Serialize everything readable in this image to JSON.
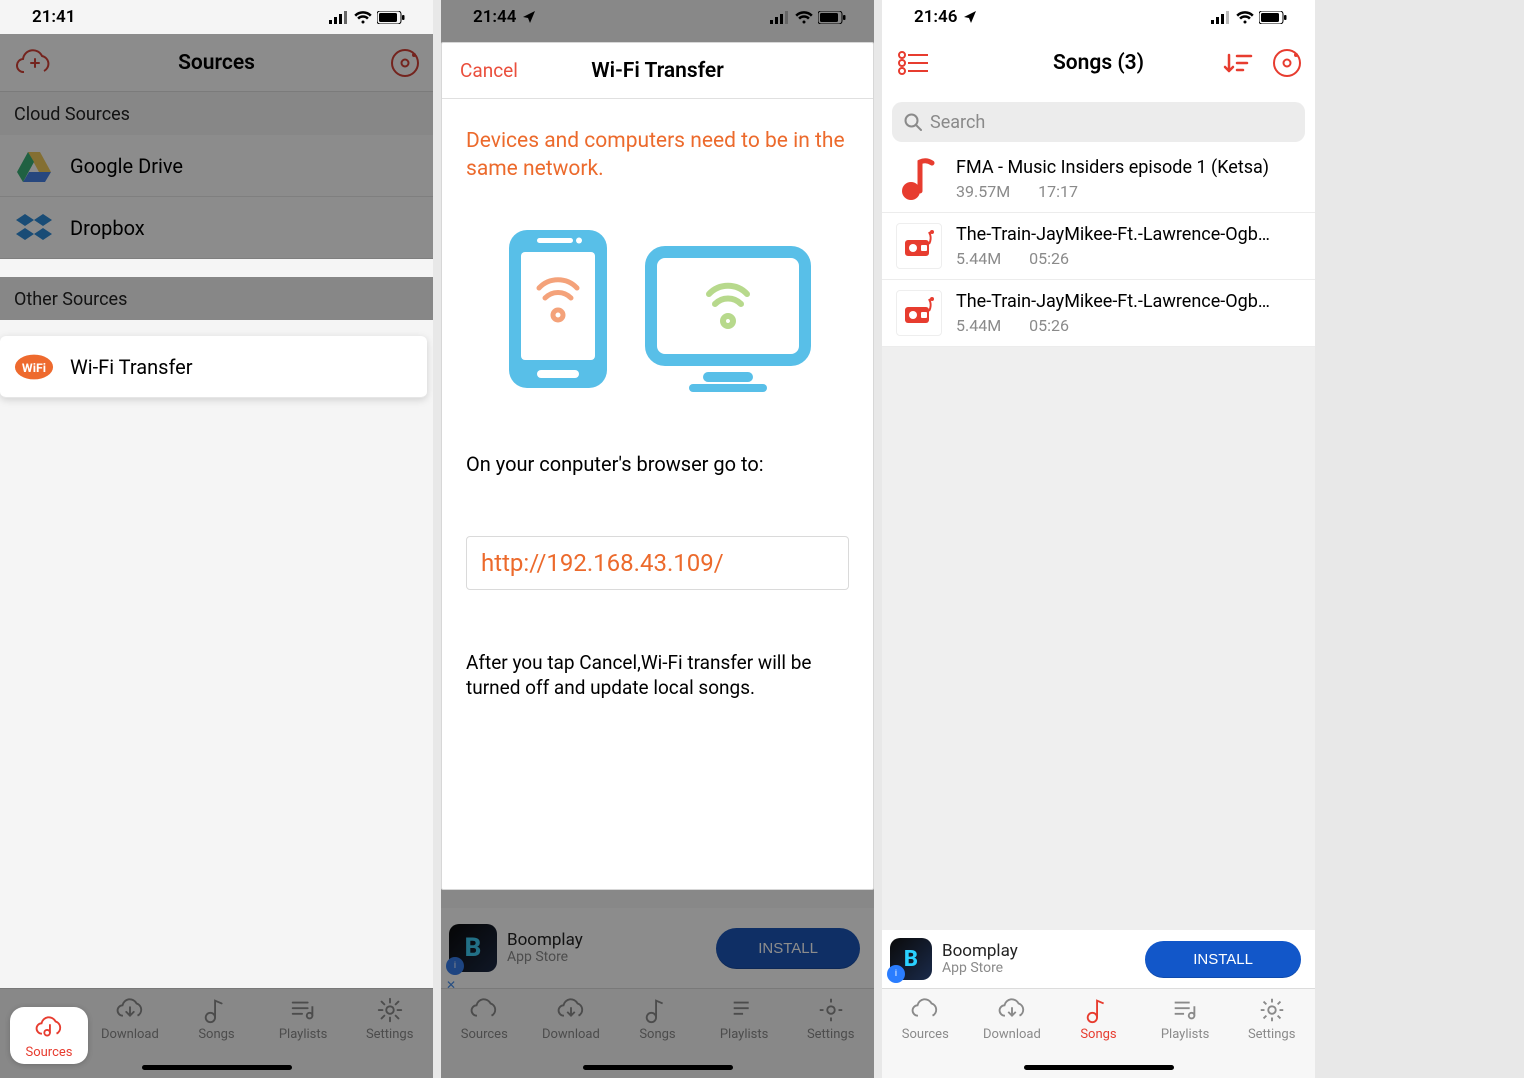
{
  "accent": "#e73c2f",
  "screen1": {
    "time": "21:41",
    "title": "Sources",
    "section1": "Cloud Sources",
    "rows1": [
      "Google Drive",
      "Dropbox"
    ],
    "section2": "Other Sources",
    "wifi_row": "Wi-Fi Transfer",
    "tabs": [
      "Sources",
      "Download",
      "Songs",
      "Playlists",
      "Settings"
    ],
    "active_tab": 0
  },
  "screen2": {
    "time": "21:44",
    "cancel": "Cancel",
    "title": "Wi-Fi Transfer",
    "network_msg": "Devices and computers need to be in the same network.",
    "instruction": "On your conputer's browser go to:",
    "url": "http://192.168.43.109/",
    "after_msg": "After you tap Cancel,Wi-Fi transfer will be turned off and update local songs.",
    "ad": {
      "title": "Boomplay",
      "sub": "App Store",
      "button": "INSTALL"
    },
    "tabs": [
      "Sources",
      "Download",
      "Songs",
      "Playlists",
      "Settings"
    ]
  },
  "screen3": {
    "time": "21:46",
    "title": "Songs (3)",
    "search_placeholder": "Search",
    "songs": [
      {
        "title": "FMA - Music Insiders episode 1 (Ketsa)",
        "size": "39.57M",
        "duration": "17:17",
        "kind": "audio"
      },
      {
        "title": "The-Train-JayMikee-Ft.-Lawrence-Ogb…",
        "size": "5.44M",
        "duration": "05:26",
        "kind": "video"
      },
      {
        "title": "The-Train-JayMikee-Ft.-Lawrence-Ogb…",
        "size": "5.44M",
        "duration": "05:26",
        "kind": "video"
      }
    ],
    "ad": {
      "title": "Boomplay",
      "sub": "App Store",
      "button": "INSTALL"
    },
    "tabs": [
      "Sources",
      "Download",
      "Songs",
      "Playlists",
      "Settings"
    ],
    "active_tab": 2
  }
}
